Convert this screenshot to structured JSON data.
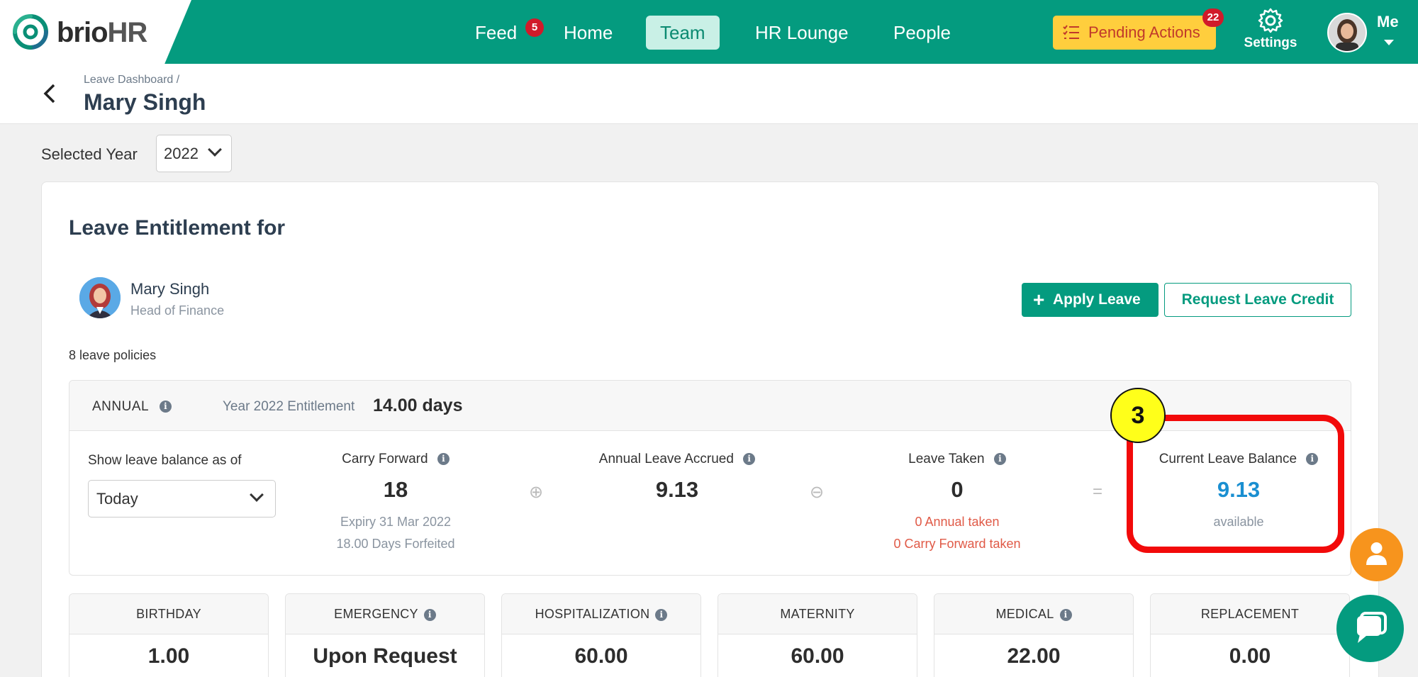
{
  "brand": {
    "name_part1": "brio",
    "name_part2": "HR"
  },
  "nav": {
    "feed": "Feed",
    "feed_badge": "5",
    "home": "Home",
    "team": "Team",
    "hr_lounge": "HR Lounge",
    "people": "People",
    "pending_actions": "Pending Actions",
    "pending_badge": "22",
    "settings": "Settings",
    "me": "Me"
  },
  "breadcrumb": {
    "parent": "Leave Dashboard",
    "separator": "/",
    "current": "Mary Singh"
  },
  "year_filter": {
    "label": "Selected Year",
    "value": "2022"
  },
  "entitlement": {
    "title": "Leave Entitlement for",
    "employee": {
      "name": "Mary Singh",
      "role": "Head of Finance"
    },
    "apply_leave": "Apply Leave",
    "request_credit": "Request Leave Credit",
    "policies_count": "8 leave policies"
  },
  "annual": {
    "label": "ANNUAL",
    "entitlement_label": "Year 2022 Entitlement",
    "entitlement_value": "14.00 days",
    "as_of_label": "Show leave balance as of",
    "as_of_value": "Today",
    "carry_forward": {
      "label": "Carry Forward",
      "value": "18",
      "expiry": "Expiry 31 Mar 2022",
      "forfeited": "18.00 Days Forfeited"
    },
    "accrued": {
      "label": "Annual Leave Accrued",
      "value": "9.13"
    },
    "taken": {
      "label": "Leave Taken",
      "value": "0",
      "annual_taken": "0 Annual taken",
      "carry_taken": "0 Carry Forward taken"
    },
    "balance": {
      "label": "Current Leave Balance",
      "value": "9.13",
      "sub": "available"
    },
    "op_plus": "⊕",
    "op_minus": "⊖",
    "op_equals": "="
  },
  "annotation": {
    "step": "3"
  },
  "tiles": [
    {
      "label": "BIRTHDAY",
      "value": "1.00",
      "info": false
    },
    {
      "label": "EMERGENCY",
      "value": "Upon Request",
      "info": true
    },
    {
      "label": "HOSPITALIZATION",
      "value": "60.00",
      "info": true
    },
    {
      "label": "MATERNITY",
      "value": "60.00",
      "info": false
    },
    {
      "label": "MEDICAL",
      "value": "22.00",
      "info": true
    },
    {
      "label": "REPLACEMENT",
      "value": "0.00",
      "info": false
    }
  ],
  "colors": {
    "brand": "#049b7f",
    "pending": "#ffce3d",
    "highlight": "#f20a0a",
    "balance": "#1a8fd1"
  }
}
